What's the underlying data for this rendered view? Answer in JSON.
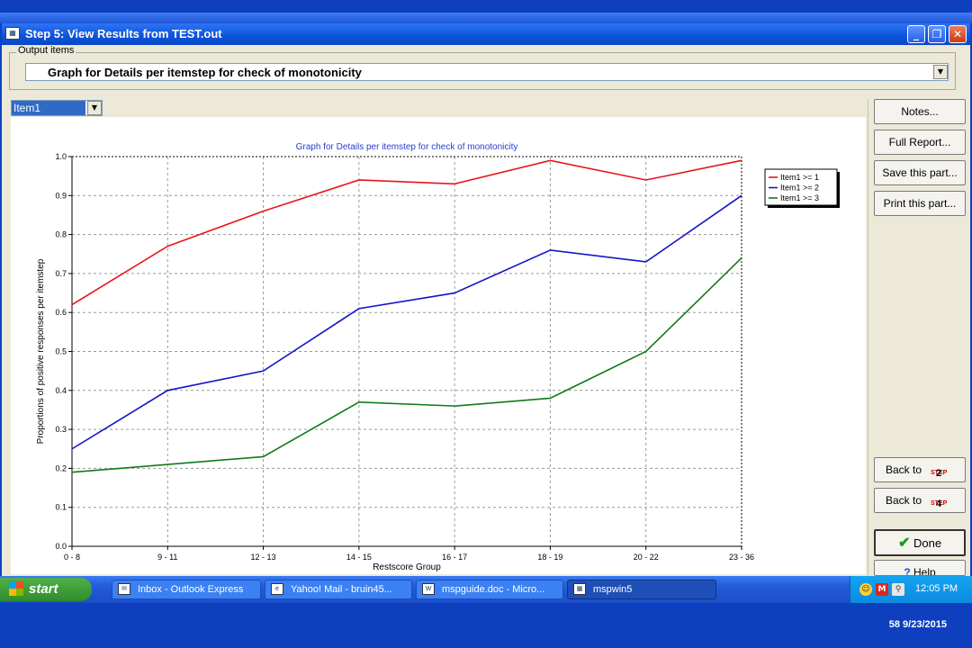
{
  "window": {
    "title": "Step 5: View Results from TEST.out",
    "controls": {
      "minimize": "_",
      "restore": "❐",
      "close": "✕"
    }
  },
  "output_items": {
    "label": "Output items",
    "selected": "Graph for Details per itemstep for check of monotonicity"
  },
  "item_select": {
    "selected": "Item1"
  },
  "buttons": {
    "notes": "Notes...",
    "full_report": "Full Report...",
    "save_part": "Save this part...",
    "print_part": "Print this part...",
    "back_step2": {
      "label": "Back to",
      "step_word": "STEP",
      "step": "2"
    },
    "back_step4": {
      "label": "Back to",
      "step_word": "STEP",
      "step": "4"
    },
    "done": "Done",
    "help": "Help"
  },
  "chart_data": {
    "type": "line",
    "title": "Graph for Details per itemstep for check of monotonicity",
    "xlabel": "Restscore Group",
    "ylabel": "Proportions of positive responses per itemstep",
    "categories": [
      "0 - 8",
      "9 - 11",
      "12 - 13",
      "14 - 15",
      "16 - 17",
      "18 - 19",
      "20 - 22",
      "23 - 36"
    ],
    "ylim": [
      0,
      1.0
    ],
    "yticks": [
      "0.0",
      "0.1",
      "0.2",
      "0.3",
      "0.4",
      "0.5",
      "0.6",
      "0.7",
      "0.8",
      "0.9",
      "1.0"
    ],
    "grid": true,
    "legend_position": "top-right",
    "series": [
      {
        "name": "Item1 >=  1",
        "color": "#e8141c",
        "values": [
          0.62,
          0.77,
          0.86,
          0.94,
          0.93,
          0.99,
          0.94,
          0.99
        ]
      },
      {
        "name": "Item1 >=  2",
        "color": "#1414c8",
        "values": [
          0.25,
          0.4,
          0.45,
          0.61,
          0.65,
          0.76,
          0.73,
          0.9
        ]
      },
      {
        "name": "Item1 >=  3",
        "color": "#117a1a",
        "values": [
          0.19,
          0.21,
          0.23,
          0.37,
          0.36,
          0.38,
          0.5,
          0.74
        ]
      }
    ]
  },
  "taskbar": {
    "start_label": "start",
    "items": [
      {
        "label": "Inbox - Outlook Express",
        "icon": "mail-icon"
      },
      {
        "label": "Yahoo! Mail - bruin45...",
        "icon": "browser-icon"
      },
      {
        "label": "mspguide.doc - Micro...",
        "icon": "word-icon"
      },
      {
        "label": "mspwin5",
        "icon": "app-icon"
      }
    ],
    "clock": "12:05 PM"
  },
  "footer": "58 9/23/2015"
}
